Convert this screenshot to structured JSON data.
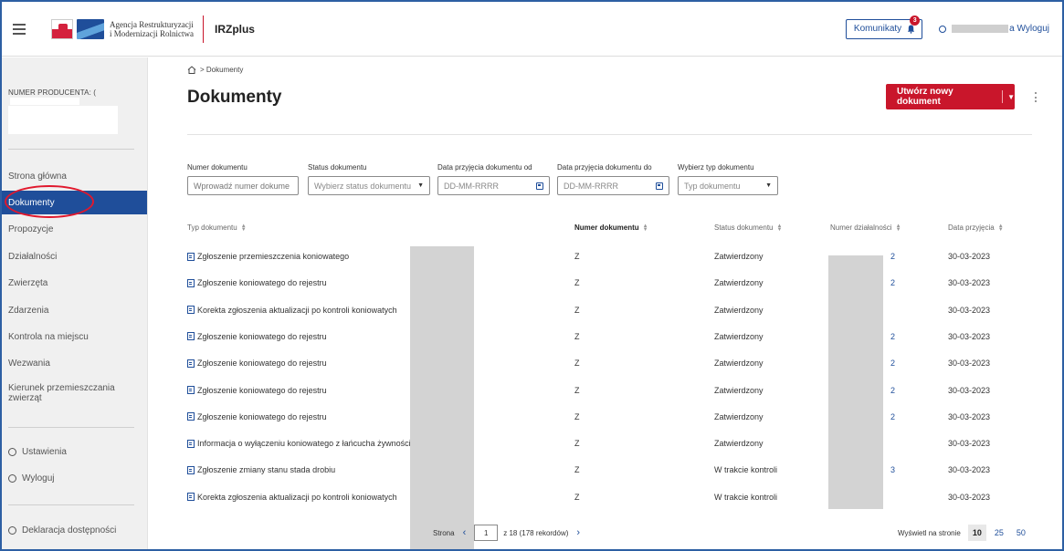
{
  "header": {
    "agency_line1": "Agencja Restrukturyzacji",
    "agency_line2": "i Modernizacji Rolnictwa",
    "app_name": "IRZplus",
    "komunikaty_label": "Komunikaty",
    "komunikaty_count": "3",
    "user_name_suffix": "a Wyloguj",
    "accent": "#c9162b",
    "brand_blue": "#1f4e9a"
  },
  "sidebar": {
    "producer_label": "NUMER PRODUCENTA: (",
    "items": [
      {
        "label": "Strona główna"
      },
      {
        "label": "Dokumenty"
      },
      {
        "label": "Propozycje"
      },
      {
        "label": "Działalności"
      },
      {
        "label": "Zwierzęta"
      },
      {
        "label": "Zdarzenia"
      },
      {
        "label": "Kontrola na miejscu"
      },
      {
        "label": "Wezwania"
      },
      {
        "label": "Kierunek przemieszczania zwierząt"
      }
    ],
    "settings_label": "Ustawienia",
    "logout_label": "Wyloguj",
    "accessibility_label": "Deklaracja dostępności"
  },
  "main": {
    "breadcrumb": "> Dokumenty",
    "title": "Dokumenty",
    "new_doc_label": "Utwórz nowy dokument"
  },
  "filters": {
    "numer": {
      "label": "Numer dokumentu",
      "placeholder": "Wprowadź numer dokume"
    },
    "status": {
      "label": "Status dokumentu",
      "value": "Wybierz status dokumentu"
    },
    "date_from": {
      "label": "Data przyjęcia dokumentu od",
      "placeholder": "DD-MM-RRRR"
    },
    "date_to": {
      "label": "Data przyjęcia dokumentu do",
      "placeholder": "DD-MM-RRRR"
    },
    "typ": {
      "label": "Wybierz typ dokumentu",
      "value": "Typ dokumentu"
    }
  },
  "table": {
    "columns": [
      "Typ dokumentu",
      "Numer dokumentu",
      "Status dokumentu",
      "Numer działalności",
      "Data przyjęcia"
    ],
    "rows": [
      {
        "type": "Zgłoszenie przemieszczenia koniowatego",
        "num": "Z",
        "status": "Zatwierdzony",
        "dz": "2",
        "date": "30-03-2023"
      },
      {
        "type": "Zgłoszenie koniowatego do rejestru",
        "num": "Z",
        "status": "Zatwierdzony",
        "dz": "2",
        "date": "30-03-2023"
      },
      {
        "type": "Korekta zgłoszenia aktualizacji po kontroli koniowatych",
        "num": "Z",
        "status": "Zatwierdzony",
        "dz": "",
        "date": "30-03-2023"
      },
      {
        "type": "Zgłoszenie koniowatego do rejestru",
        "num": "Z",
        "status": "Zatwierdzony",
        "dz": "2",
        "date": "30-03-2023"
      },
      {
        "type": "Zgłoszenie koniowatego do rejestru",
        "num": "Z",
        "status": "Zatwierdzony",
        "dz": "2",
        "date": "30-03-2023"
      },
      {
        "type": "Zgłoszenie koniowatego do rejestru",
        "num": "Z",
        "status": "Zatwierdzony",
        "dz": "2",
        "date": "30-03-2023"
      },
      {
        "type": "Zgłoszenie koniowatego do rejestru",
        "num": "Z",
        "status": "Zatwierdzony",
        "dz": "2",
        "date": "30-03-2023"
      },
      {
        "type": "Informacja o wyłączeniu koniowatego z łańcucha żywnościowego",
        "num": "Z",
        "status": "Zatwierdzony",
        "dz": "",
        "date": "30-03-2023"
      },
      {
        "type": "Zgłoszenie zmiany stanu stada drobiu",
        "num": "Z",
        "status": "W trakcie kontroli",
        "dz": "3",
        "date": "30-03-2023"
      },
      {
        "type": "Korekta zgłoszenia aktualizacji po kontroli koniowatych",
        "num": "Z",
        "status": "W trakcie kontroli",
        "dz": "",
        "date": "30-03-2023"
      }
    ]
  },
  "pagination": {
    "strona_label": "Strona",
    "page": "1",
    "of_text": "z 18 (178 rekordów)",
    "per_page_label": "Wyświetl na stronie",
    "sizes": [
      "10",
      "25",
      "50"
    ],
    "selected": "10"
  }
}
